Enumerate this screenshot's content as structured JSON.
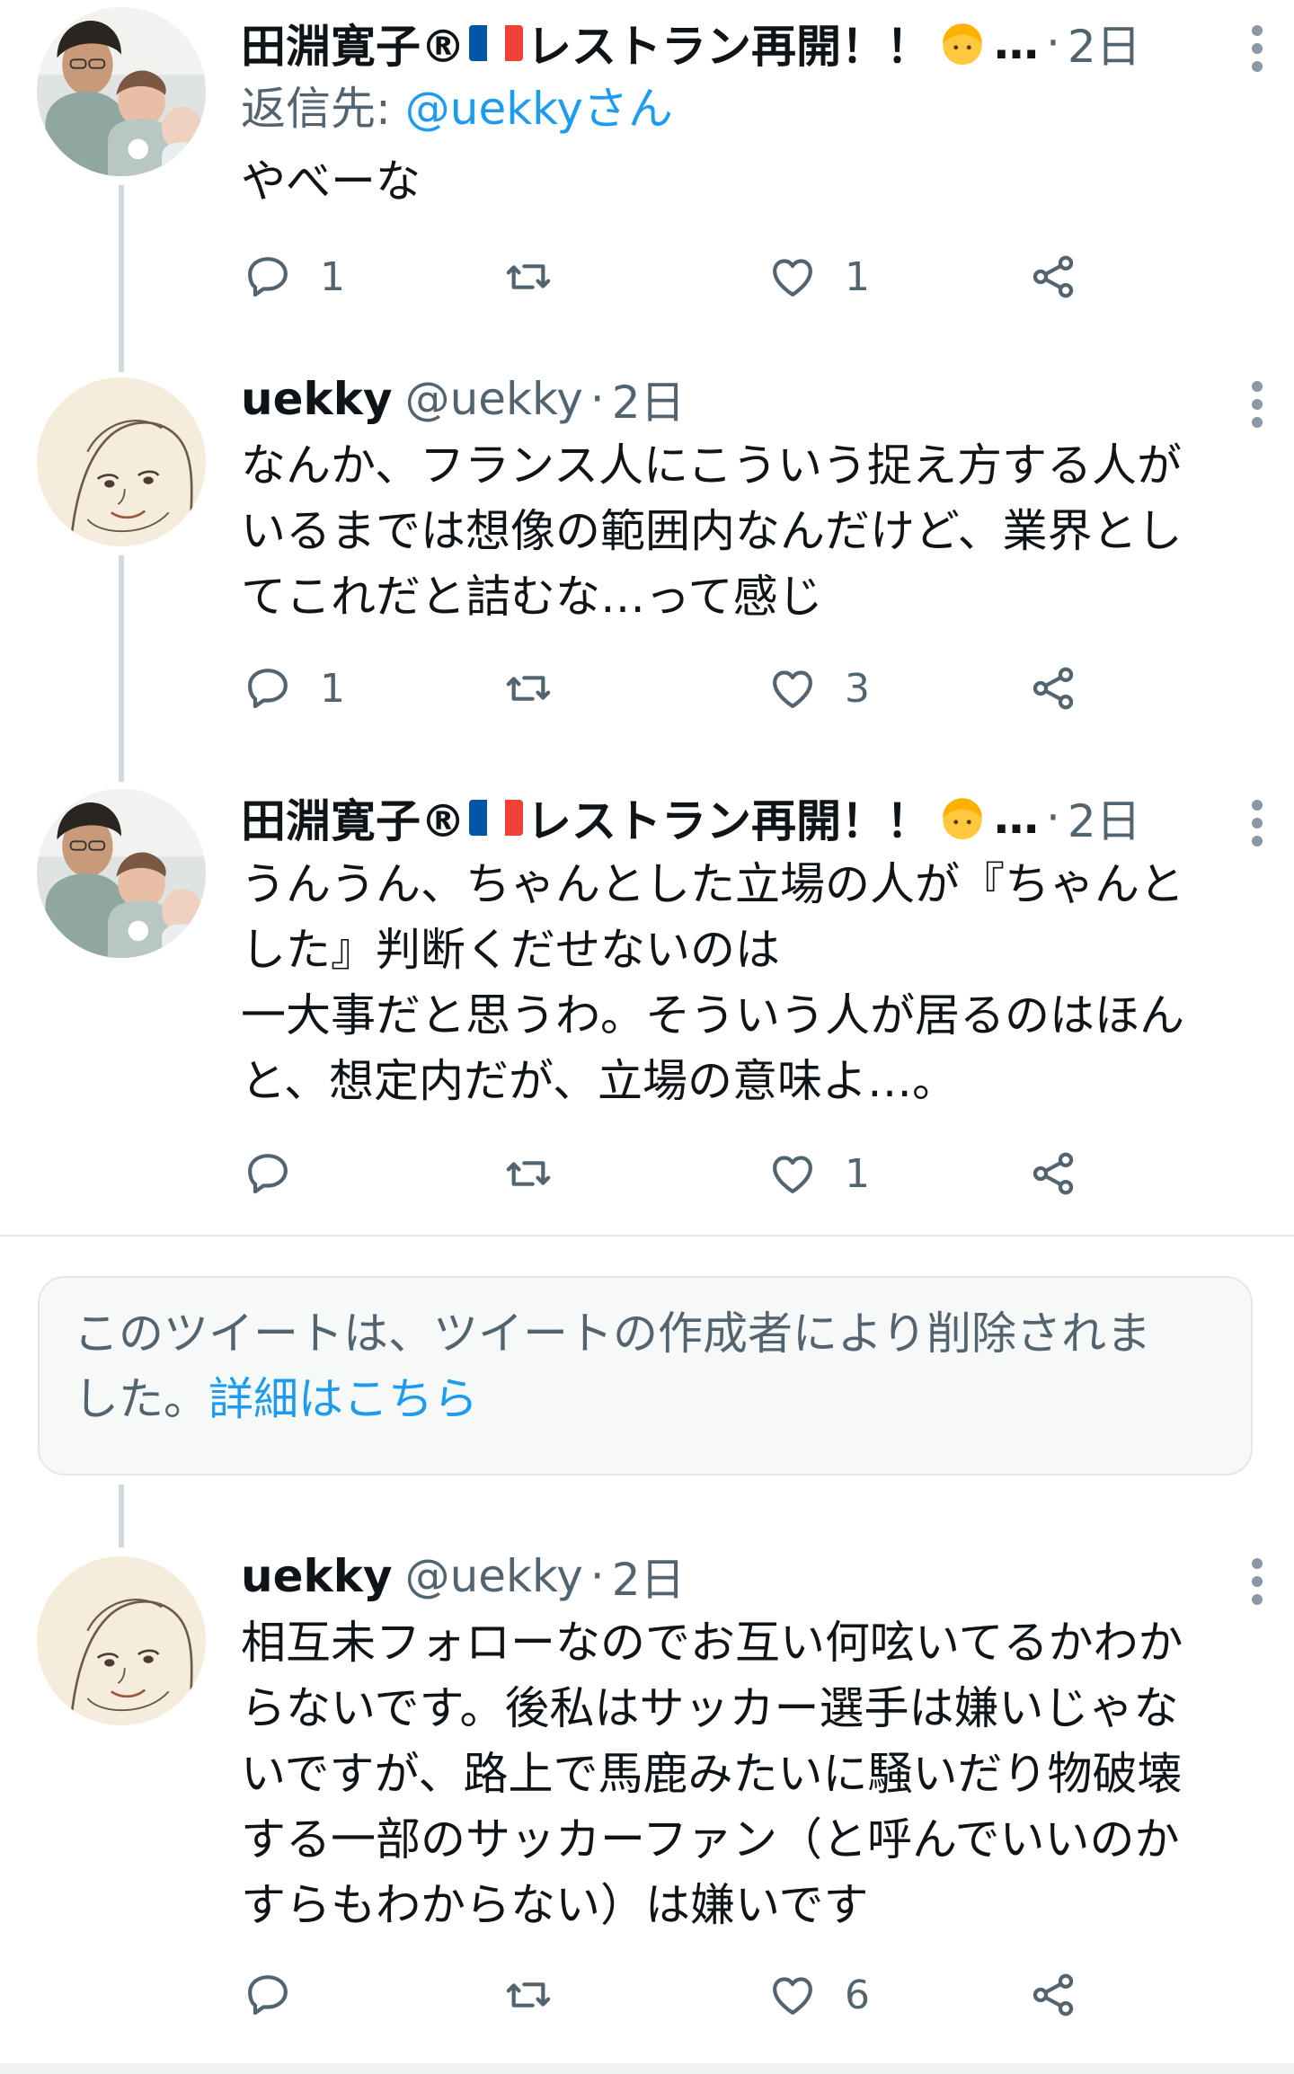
{
  "tweets": [
    {
      "name": "田淵寛子®",
      "name_suffix": "レストラン再開！！",
      "ellipsis": "…",
      "time": "2日",
      "reply_to_label": "返信先: ",
      "reply_to_user": "@uekkyさん",
      "text": "やべーな",
      "replies": "1",
      "retweets": "",
      "likes": "1"
    },
    {
      "name": "uekky",
      "handle": "@uekky",
      "time": "2日",
      "text": "なんか、フランス人にこういう捉え方する人が\nいるまでは想像の範囲内なんだけど、業界とし\nてこれだと詰むな…って感じ",
      "replies": "1",
      "retweets": "",
      "likes": "3"
    },
    {
      "name": "田淵寛子®",
      "name_suffix": "レストラン再開！！",
      "ellipsis": "…",
      "time": "2日",
      "text": "うんうん、ちゃんとした立場の人が『ちゃんと\nした』判断くだせないのは\n一大事だと思うわ。そういう人が居るのはほん\nと、想定内だが、立場の意味よ…。",
      "replies": "",
      "retweets": "",
      "likes": "1"
    },
    {
      "name": "uekky",
      "handle": "@uekky",
      "time": "2日",
      "text": "相互未フォローなのでお互い何呟いてるかわか\nらないです。後私はサッカー選手は嫌いじゃな\nいですが、路上で馬鹿みたいに騒いだり物破壊\nする一部のサッカーファン（と呼んでいいのか\nすらもわからない）は嫌いです",
      "replies": "",
      "retweets": "",
      "likes": "6"
    }
  ],
  "deleted_notice": {
    "text": "このツイートは、ツイートの作成者により削除されま\nした。",
    "link": "詳細はこちら"
  },
  "colors": {
    "accent": "#1d9bf0",
    "secondary_text": "#536471",
    "thread_line": "#cfd9de"
  },
  "icons": [
    "reply-icon",
    "retweet-icon",
    "like-icon",
    "share-icon",
    "more-icon"
  ]
}
